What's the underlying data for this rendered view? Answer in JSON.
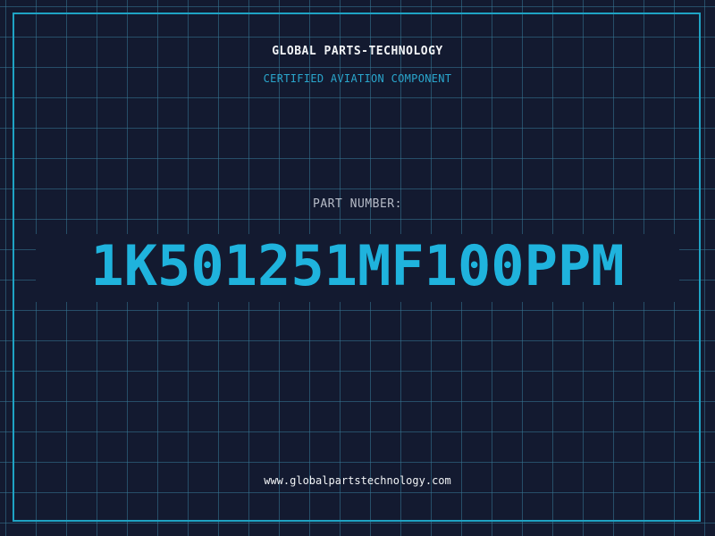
{
  "header": {
    "company": "GLOBAL PARTS-TECHNOLOGY",
    "tagline": "CERTIFIED AVIATION COMPONENT"
  },
  "part": {
    "label": "PART NUMBER:",
    "number": "1K501251MF100PPM"
  },
  "footer": {
    "website": "www.globalpartstechnology.com"
  },
  "colors": {
    "background": "#131a30",
    "grid": "#36789a",
    "frame": "#1fa3c4",
    "accent": "#1fb3dd",
    "text": "#f2f4f6"
  }
}
